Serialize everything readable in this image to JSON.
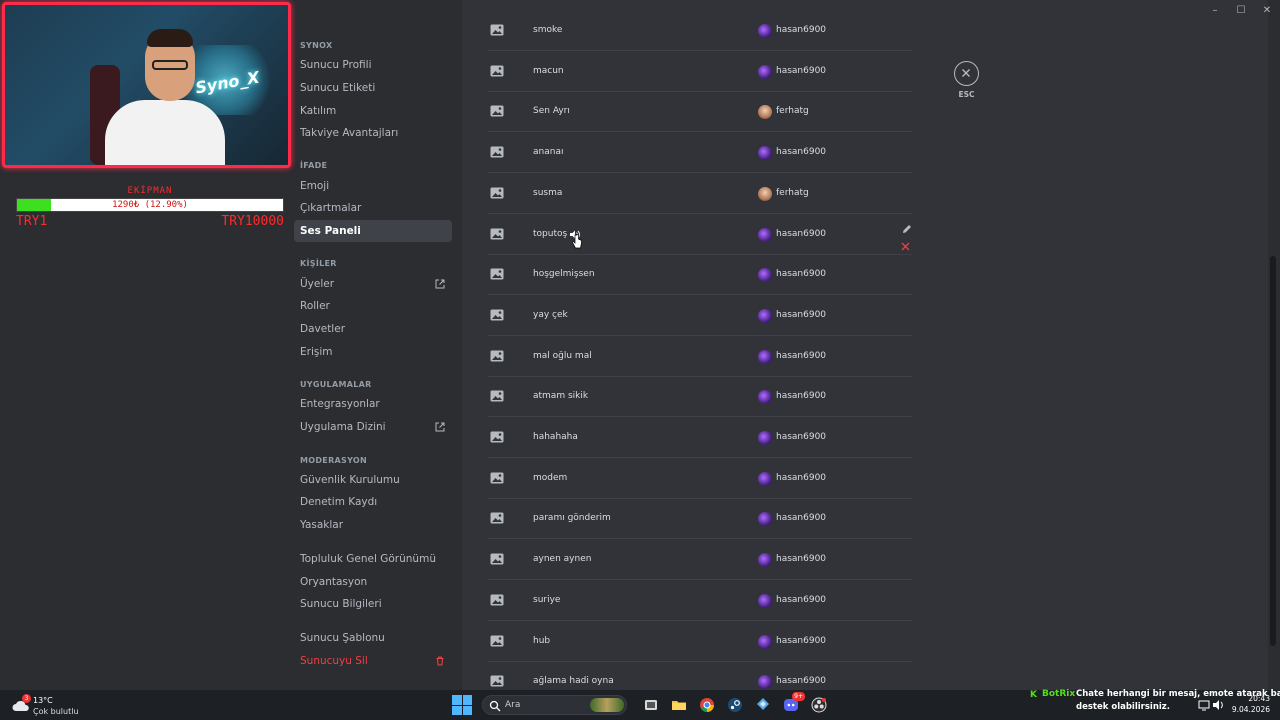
{
  "webcam": {
    "overlay_text": "Syno_X"
  },
  "donation": {
    "title": "EKİPMAN",
    "progress_text": "1290₺ (12.90%)",
    "progress_fraction": 0.129,
    "min_label": "TRY1",
    "max_label": "TRY10000"
  },
  "nav": {
    "sections": [
      {
        "header": "SYNOX",
        "items": [
          "Sunucu Profili",
          "Sunucu Etiketi",
          "Katılım",
          "Takviye Avantajları"
        ]
      },
      {
        "header": "İFADE",
        "items": [
          "Emoji",
          "Çıkartmalar",
          "Ses Paneli"
        ]
      },
      {
        "header": "KİŞİLER",
        "items": [
          "Üyeler",
          "Roller",
          "Davetler",
          "Erişim"
        ]
      },
      {
        "header": "UYGULAMALAR",
        "items": [
          "Entegrasyonlar",
          "Uygulama Dizini"
        ]
      },
      {
        "header": "MODERASYON",
        "items": [
          "Güvenlik Kurulumu",
          "Denetim Kaydı",
          "Yasaklar"
        ]
      },
      {
        "header": "",
        "items": [
          "Topluluk Genel Görünümü",
          "Oryantasyon",
          "Sunucu Bilgileri"
        ]
      },
      {
        "header": "",
        "items": [
          "Sunucu Şablonu",
          "Sunucuyu Sil"
        ]
      }
    ],
    "active_item": "Ses Paneli"
  },
  "sounds": [
    {
      "name": "smoke",
      "user": "hasan6900"
    },
    {
      "name": "macun",
      "user": "hasan6900"
    },
    {
      "name": "Sen Ayrı",
      "user": "ferhatg"
    },
    {
      "name": "ananaı",
      "user": "hasan6900"
    },
    {
      "name": "susma",
      "user": "ferhatg"
    },
    {
      "name": "toputoş",
      "user": "hasan6900"
    },
    {
      "name": "hoşgelmişsen",
      "user": "hasan6900"
    },
    {
      "name": "yay çek",
      "user": "hasan6900"
    },
    {
      "name": "mal oğlu mal",
      "user": "hasan6900"
    },
    {
      "name": "atmam sikik",
      "user": "hasan6900"
    },
    {
      "name": "hahahaha",
      "user": "hasan6900"
    },
    {
      "name": "modem",
      "user": "hasan6900"
    },
    {
      "name": "paramı gönderim",
      "user": "hasan6900"
    },
    {
      "name": "aynen aynen",
      "user": "hasan6900"
    },
    {
      "name": "suriye",
      "user": "hasan6900"
    },
    {
      "name": "hub",
      "user": "hasan6900"
    },
    {
      "name": "ağlama hadi oyna",
      "user": "hasan6900"
    }
  ],
  "esc": {
    "label": "ESC"
  },
  "taskbar": {
    "weather": {
      "temp": "13°C",
      "condition": "Çok bulutlu",
      "badge": "3"
    },
    "search_placeholder": "Ara",
    "discord_badge": "9+",
    "botrix": {
      "k": "K",
      "name": "BotRix",
      "line1": "Chate herhangi bir mesaj, emote atarak bana",
      "line2": "destek olabilirsiniz."
    },
    "clock_time": "20:43",
    "clock_date": "9.04.2026"
  }
}
